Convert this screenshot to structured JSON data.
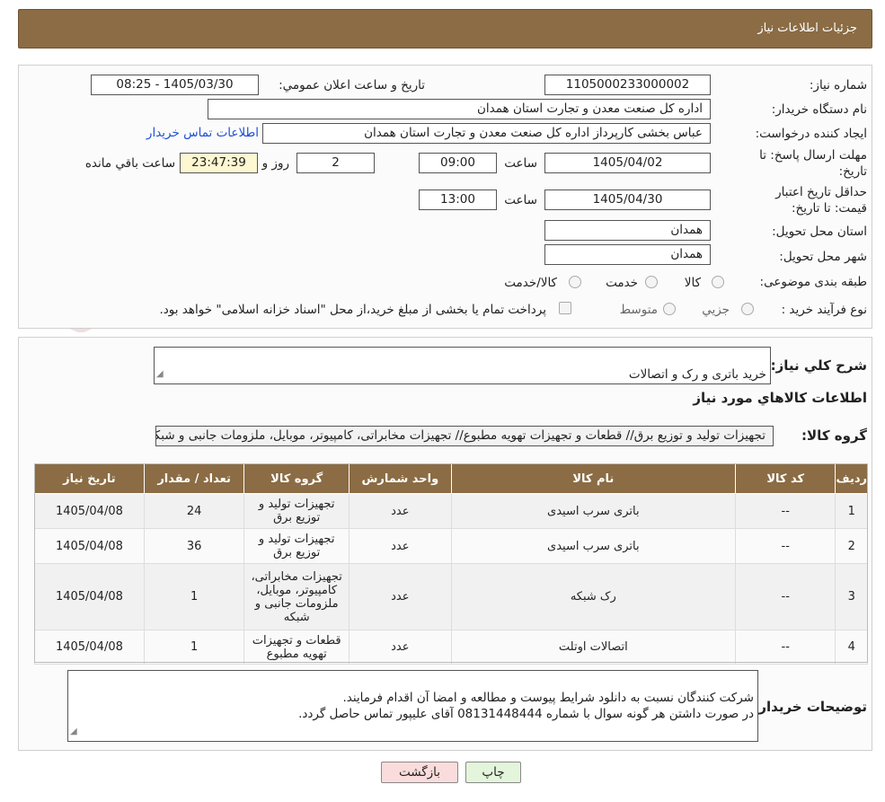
{
  "header": {
    "title": "جزئيات اطلاعات نیاز"
  },
  "watermark": {
    "text": "AriaTender.neT"
  },
  "fields": {
    "need_number_label": "شماره نياز:",
    "need_number": "1105000233000002",
    "announce_label": "تاريخ و ساعت اعلان عمومي:",
    "announce_value": "1405/03/30 - 08:25",
    "buyer_org_label": "نام دستگاه خريدار:",
    "buyer_org": "اداره کل صنعت  معدن و تجارت استان همدان",
    "creator_label": "ايجاد کننده درخواست:",
    "creator": "عباس بخشی کارپرداز اداره کل صنعت  معدن و تجارت استان همدان",
    "contact_link": "اطلاعات تماس خريدار",
    "reply_deadline_label": "مهلت ارسال پاسخ: تا تاريخ:",
    "reply_date": "1405/04/02",
    "time_word": "ساعت",
    "reply_time": "09:00",
    "days_value": "2",
    "days_word": "روز و",
    "remaining_time": "23:47:39",
    "remaining_word": "ساعت باقي مانده",
    "price_validity_label": "حداقل تاريخ اعتبار قيمت: تا تاريخ:",
    "price_validity_date": "1405/04/30",
    "price_validity_time": "13:00",
    "province_label": "استان محل تحويل:",
    "province": "همدان",
    "city_label": "شهر محل تحويل:",
    "city": "همدان",
    "category_label": "طبقه بندی موضوعی:",
    "category_options": [
      "کالا",
      "خدمت",
      "کالا/خدمت"
    ],
    "process_label": "نوع فرآيند خريد :",
    "process_options": [
      "جزيي",
      "متوسط"
    ],
    "payment_note": "پرداخت تمام يا بخشی از مبلغ خريد،از محل \"اسناد خزانه اسلامی\" خواهد بود."
  },
  "summary": {
    "label": "شرح کلي نياز:",
    "value": "خريد باتری و رک و اتصالات",
    "items_heading": "اطلاعات کالاهاي مورد نياز",
    "group_label": "گروه کالا:",
    "group_value": "تجهیزات تولید و توزیع برق//  قطعات و تجهیزات تهویه مطبوع// تجهیزات مخابراتی، کامپیوتر، موبایل، ملزومات جانبی و شبکه"
  },
  "table": {
    "headers": [
      "رديف",
      "کد کالا",
      "نام کالا",
      "واحد شمارش",
      "گروه کالا",
      "تعداد / مقدار",
      "تاريخ نياز"
    ],
    "rows": [
      {
        "index": "1",
        "code": "--",
        "name": "باتری سرب اسیدی",
        "unit": "عدد",
        "group": "تجهیزات تولید و توزیع برق",
        "qty": "24",
        "date": "1405/04/08"
      },
      {
        "index": "2",
        "code": "--",
        "name": "باتری سرب اسیدی",
        "unit": "عدد",
        "group": "تجهیزات تولید و توزیع برق",
        "qty": "36",
        "date": "1405/04/08"
      },
      {
        "index": "3",
        "code": "--",
        "name": "رک شبکه",
        "unit": "عدد",
        "group": "تجهیزات مخابراتی، کامپیوتر، موبایل، ملزومات جانبی و شبکه",
        "qty": "1",
        "date": "1405/04/08"
      },
      {
        "index": "4",
        "code": "--",
        "name": "اتصالات اوتلت",
        "unit": "عدد",
        "group": "قطعات و تجهیزات تهویه مطبوع",
        "qty": "1",
        "date": "1405/04/08"
      }
    ]
  },
  "buyer_notes": {
    "label": "توضيحات خريدار:",
    "value": "شرکت کنندگان نسبت به دانلود شرایط پیوست و مطالعه و امضا آن اقدام فرمایند.\nدر صورت داشتن هر گونه سوال با شماره 08131448444 آقای علیپور تماس حاصل گردد."
  },
  "buttons": {
    "print": "چاپ",
    "back": "بازگشت"
  }
}
